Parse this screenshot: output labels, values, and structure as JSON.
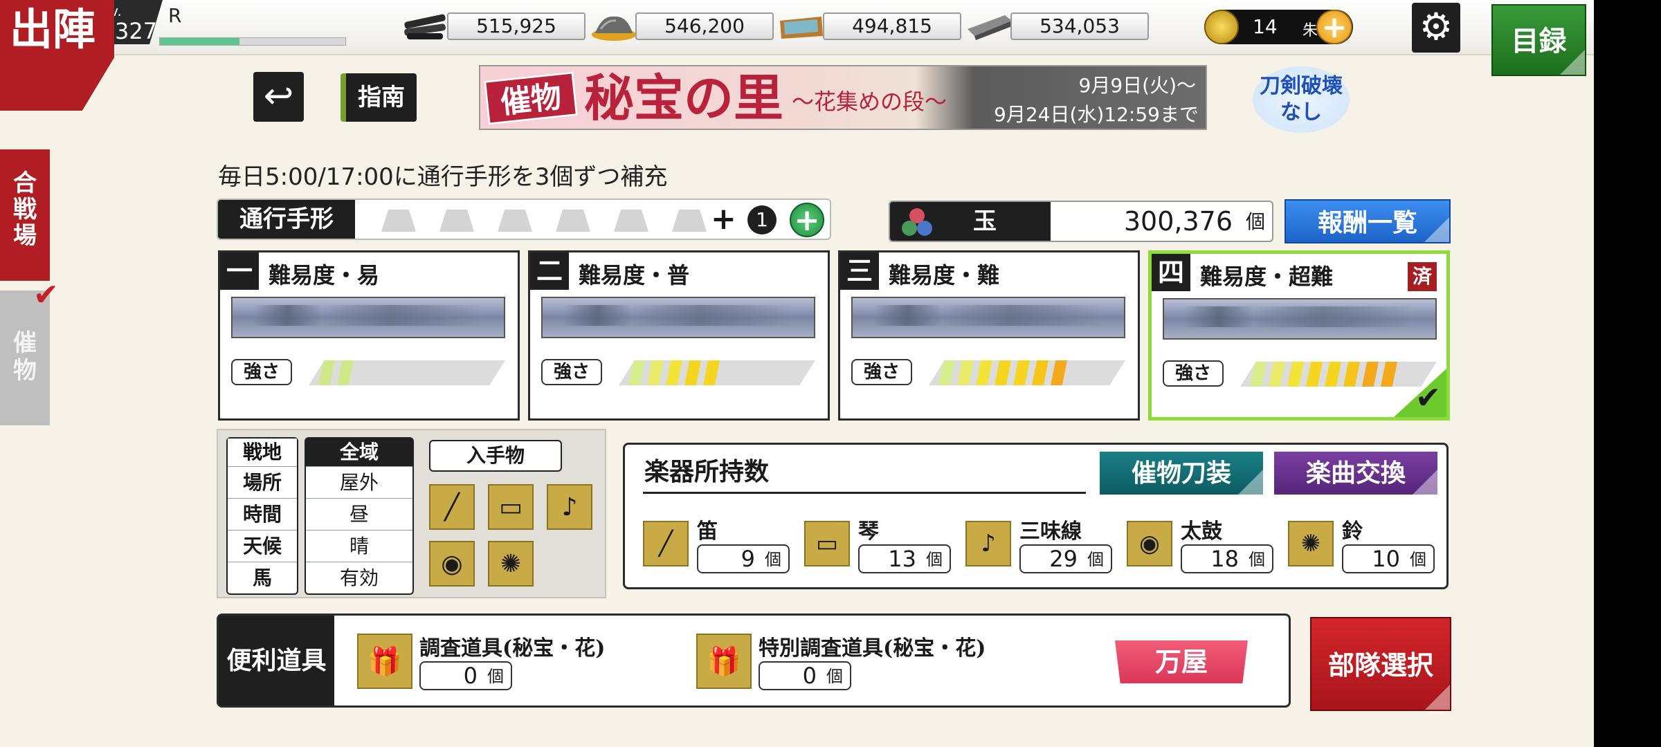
{
  "header": {
    "corner_title": "出陣",
    "level_label": "Lv.",
    "level": "327",
    "rank": "R",
    "exp_fraction": 0.43,
    "resources": [
      {
        "icon": "charcoal-icon",
        "value": "515,925"
      },
      {
        "icon": "steel-icon",
        "value": "546,200"
      },
      {
        "icon": "cooling-material-icon",
        "value": "494,815"
      },
      {
        "icon": "whetstone-icon",
        "value": "534,053"
      }
    ],
    "gold": {
      "value": "14",
      "unit": "朱"
    },
    "catalog_label": "目録"
  },
  "side_tabs": {
    "gassen": "合戦場",
    "moyoshi": "催物"
  },
  "toolbar": {
    "guide_label": "指南"
  },
  "event_banner": {
    "tag": "催物",
    "title": "秘宝の里",
    "subtitle": "〜花集めの段〜",
    "date_start": "9月9日(火)〜",
    "date_end": "9月24日(水)12:59まで"
  },
  "no_break_badge": "刀剣破壊なし",
  "info_text": "毎日5:00/17:00に通行手形を3個ずつ補充",
  "pass": {
    "label": "通行手形",
    "slots": 6,
    "extra_count": "1"
  },
  "gems": {
    "label": "玉",
    "value": "300,376",
    "unit": "個"
  },
  "reward_button": "報酬一覧",
  "difficulties": [
    {
      "num": "一",
      "title": "難易度・易",
      "strength_label": "強さ",
      "strength": 2,
      "colors": [
        "#cfe88a",
        "#cfe88a"
      ],
      "selected": false,
      "done": ""
    },
    {
      "num": "二",
      "title": "難易度・普",
      "strength_label": "強さ",
      "strength": 5,
      "colors": [
        "#d8ee8c",
        "#e8ec6a",
        "#f3e43a",
        "#f6d51e",
        "#f6d51e"
      ],
      "selected": false,
      "done": ""
    },
    {
      "num": "三",
      "title": "難易度・難",
      "strength_label": "強さ",
      "strength": 7,
      "colors": [
        "#d8ee8c",
        "#e8ec6a",
        "#f3e43a",
        "#f6d51e",
        "#f6d51e",
        "#f6c51a",
        "#f3a91a"
      ],
      "selected": false,
      "done": ""
    },
    {
      "num": "四",
      "title": "難易度・超難",
      "strength_label": "強さ",
      "strength": 8,
      "colors": [
        "#d8ee8c",
        "#e8ec6a",
        "#f3e43a",
        "#f6d51e",
        "#f6d51e",
        "#f6c51a",
        "#f3a91a",
        "#f3a91a"
      ],
      "selected": true,
      "done": "済"
    }
  ],
  "field": {
    "label_header": "戦地",
    "value_header": "全域",
    "rows": [
      {
        "label": "場所",
        "value": "屋外"
      },
      {
        "label": "時間",
        "value": "昼"
      },
      {
        "label": "天候",
        "value": "晴"
      },
      {
        "label": "馬",
        "value": "有効"
      }
    ],
    "obtain_label": "入手物",
    "obtain_items": [
      "flute-icon",
      "koto-icon",
      "shamisen-icon",
      "taiko-icon",
      "bell-icon"
    ]
  },
  "instruments": {
    "title": "楽器所持数",
    "btn_equip": "催物刀装",
    "btn_exchange": "楽曲交換",
    "items": [
      {
        "icon": "flute-icon",
        "name": "笛",
        "count": "9",
        "unit": "個"
      },
      {
        "icon": "koto-icon",
        "name": "琴",
        "count": "13",
        "unit": "個"
      },
      {
        "icon": "shamisen-icon",
        "name": "三味線",
        "count": "29",
        "unit": "個"
      },
      {
        "icon": "taiko-icon",
        "name": "太鼓",
        "count": "18",
        "unit": "個"
      },
      {
        "icon": "bell-icon",
        "name": "鈴",
        "count": "10",
        "unit": "個"
      }
    ]
  },
  "tools": {
    "label": "便利道具",
    "items": [
      {
        "icon": "survey-tool-icon",
        "name": "調査道具(秘宝・花)",
        "count": "0",
        "unit": "個"
      },
      {
        "icon": "special-survey-tool-icon",
        "name": "特別調査道具(秘宝・花)",
        "count": "0",
        "unit": "個"
      }
    ],
    "shop_label": "万屋"
  },
  "squad_button": "部隊選択"
}
